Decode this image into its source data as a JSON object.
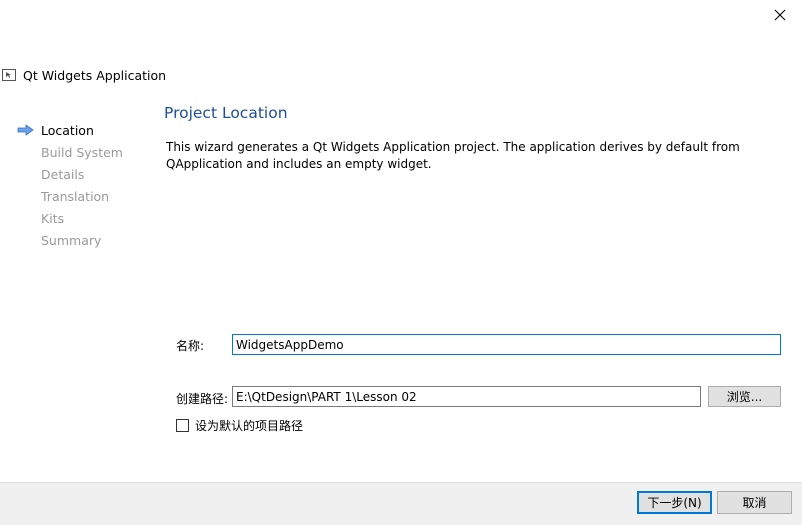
{
  "window": {
    "close_icon": "close-icon"
  },
  "wizard": {
    "title": "Qt Widgets Application",
    "app_icon": "window-icon"
  },
  "steps": [
    {
      "label": "Location",
      "active": true
    },
    {
      "label": "Build System",
      "active": false
    },
    {
      "label": "Details",
      "active": false
    },
    {
      "label": "Translation",
      "active": false
    },
    {
      "label": "Kits",
      "active": false
    },
    {
      "label": "Summary",
      "active": false
    }
  ],
  "page": {
    "title": "Project Location",
    "description": "This wizard generates a Qt Widgets Application project. The application derives by default from QApplication and includes an empty widget."
  },
  "form": {
    "name_label": "名称:",
    "name_value": "WidgetsAppDemo",
    "path_label": "创建路径:",
    "path_value": "E:\\QtDesign\\PART 1\\Lesson 02",
    "browse_label": "浏览...",
    "default_path_label": "设为默认的项目路径",
    "default_path_checked": false
  },
  "footer": {
    "next_label": "下一步(N)",
    "cancel_label": "取消"
  },
  "colors": {
    "accent": "#0078d7",
    "page_title": "#1f4e99",
    "inactive_step": "#9a9a9a",
    "step_arrow": "#4a86d8"
  }
}
